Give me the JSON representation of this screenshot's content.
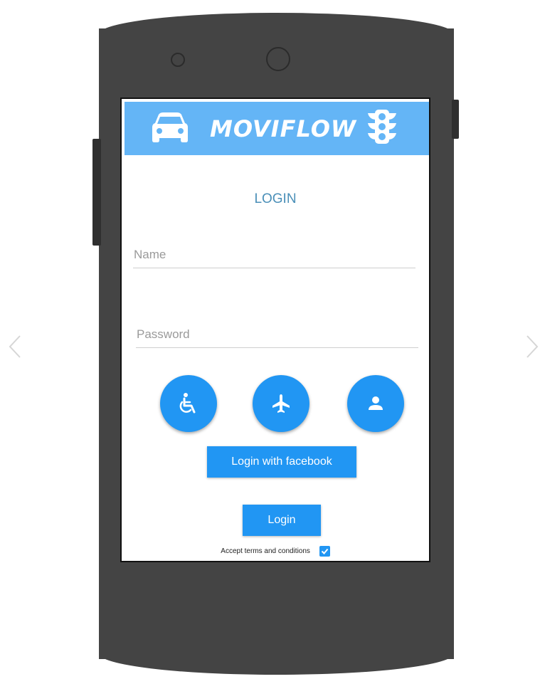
{
  "app": {
    "title": "MOVIFLOW",
    "header_color": "#64b5f6",
    "accent_color": "#2196f3",
    "header_icons": [
      "car-icon",
      "traffic-light-icon"
    ]
  },
  "login": {
    "heading": "LOGIN",
    "name_placeholder": "Name",
    "password_placeholder": "Password",
    "mode_buttons": [
      "wheelchair-icon",
      "airplane-icon",
      "person-icon"
    ],
    "facebook_label": "Login with facebook",
    "login_label": "Login",
    "terms_label": "Accept terms and conditions",
    "terms_checked": true
  },
  "navigation": {
    "prev_icon": "chevron-left-icon",
    "next_icon": "chevron-right-icon"
  }
}
